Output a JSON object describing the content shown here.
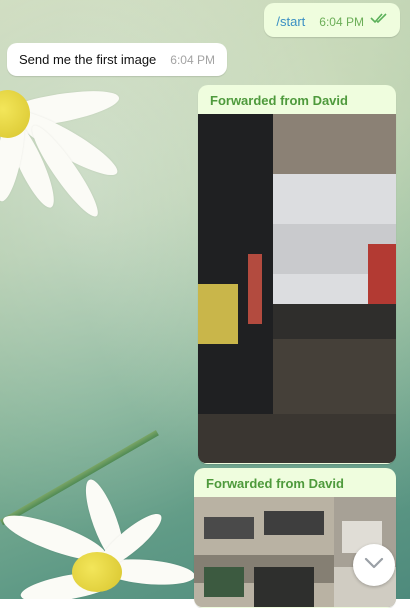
{
  "messages": {
    "outgoing": {
      "text": "/start",
      "time": "6:04 PM",
      "status_icon": "double-check-icon"
    },
    "incoming": {
      "text": "Send me the first image",
      "time": "6:04 PM"
    },
    "forwards": [
      {
        "label": "Forwarded from David"
      },
      {
        "label": "Forwarded from David"
      }
    ]
  },
  "controls": {
    "scroll_down_icon": "chevron-down-icon"
  },
  "colors": {
    "outgoing_bubble": "#effdde",
    "incoming_bubble": "#ffffff",
    "forward_label": "#4e9a3c",
    "command_link": "#3a8fc4",
    "read_check": "#5bb05a"
  }
}
